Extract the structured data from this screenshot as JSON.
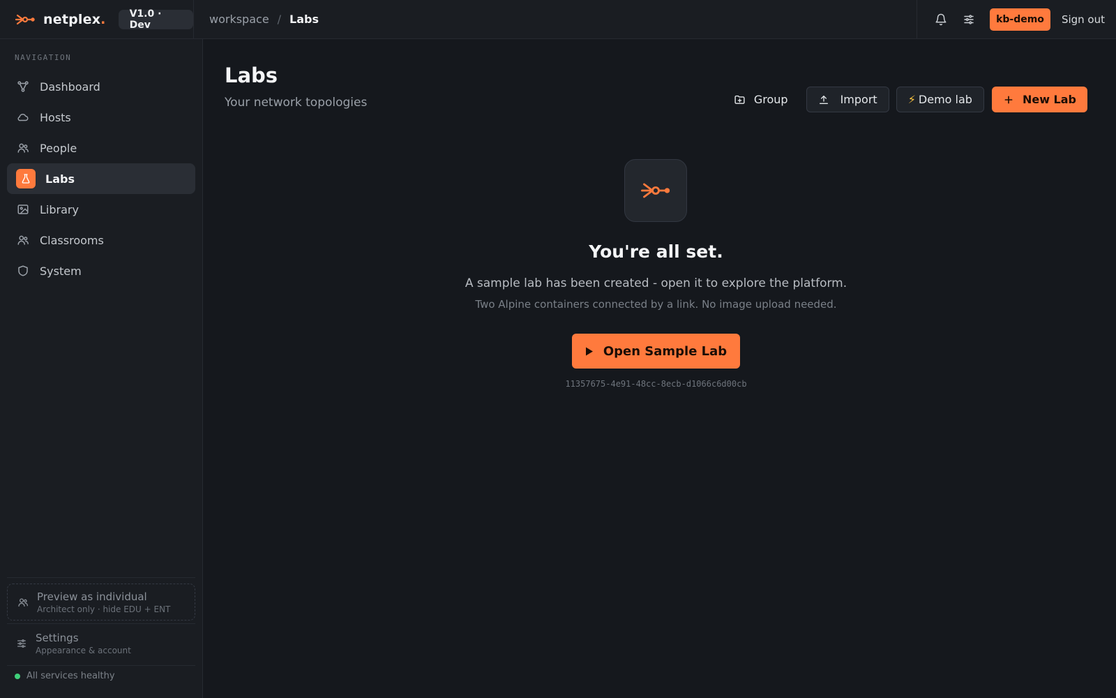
{
  "colors": {
    "accent": "#ff7a3d",
    "background": "#15181d",
    "surface": "#1a1d22",
    "health_ok": "#3fd07a"
  },
  "header": {
    "brand_name": "netplex",
    "brand_dot": ".",
    "version": "V1.0 · Dev",
    "breadcrumb": {
      "root": "workspace",
      "separator": "/",
      "current": "Labs"
    },
    "icons": [
      "bell-icon",
      "sliders-icon"
    ],
    "user": "kb-demo",
    "sign_out": "Sign out"
  },
  "sidebar": {
    "heading": "NAVIGATION",
    "items": [
      {
        "label": "Dashboard",
        "icon": "topology-icon",
        "active": false
      },
      {
        "label": "Hosts",
        "icon": "cloud-icon",
        "active": false
      },
      {
        "label": "People",
        "icon": "users-icon",
        "active": false
      },
      {
        "label": "Labs",
        "icon": "flask-icon",
        "active": true
      },
      {
        "label": "Library",
        "icon": "image-icon",
        "active": false
      },
      {
        "label": "Classrooms",
        "icon": "users-icon",
        "active": false
      },
      {
        "label": "System",
        "icon": "shield-icon",
        "active": false
      }
    ],
    "preview": {
      "title": "Preview as individual",
      "subtitle": "Architect only · hide EDU + ENT"
    },
    "settings": {
      "title": "Settings",
      "subtitle": "Appearance & account"
    },
    "health": "All services healthy"
  },
  "main": {
    "title": "Labs",
    "subtitle": "Your network topologies",
    "actions": {
      "group": "Group",
      "import": "Import",
      "demo": "Demo lab",
      "new": "New Lab"
    },
    "empty_state": {
      "icon": "netplex-logo-icon",
      "title": "You're all set.",
      "description": "A sample lab has been created - open it to explore the platform.",
      "note": "Two Alpine containers connected by a link. No image upload needed.",
      "button": "Open Sample Lab",
      "lab_id": "11357675-4e91-48cc-8ecb-d1066c6d00cb"
    }
  }
}
